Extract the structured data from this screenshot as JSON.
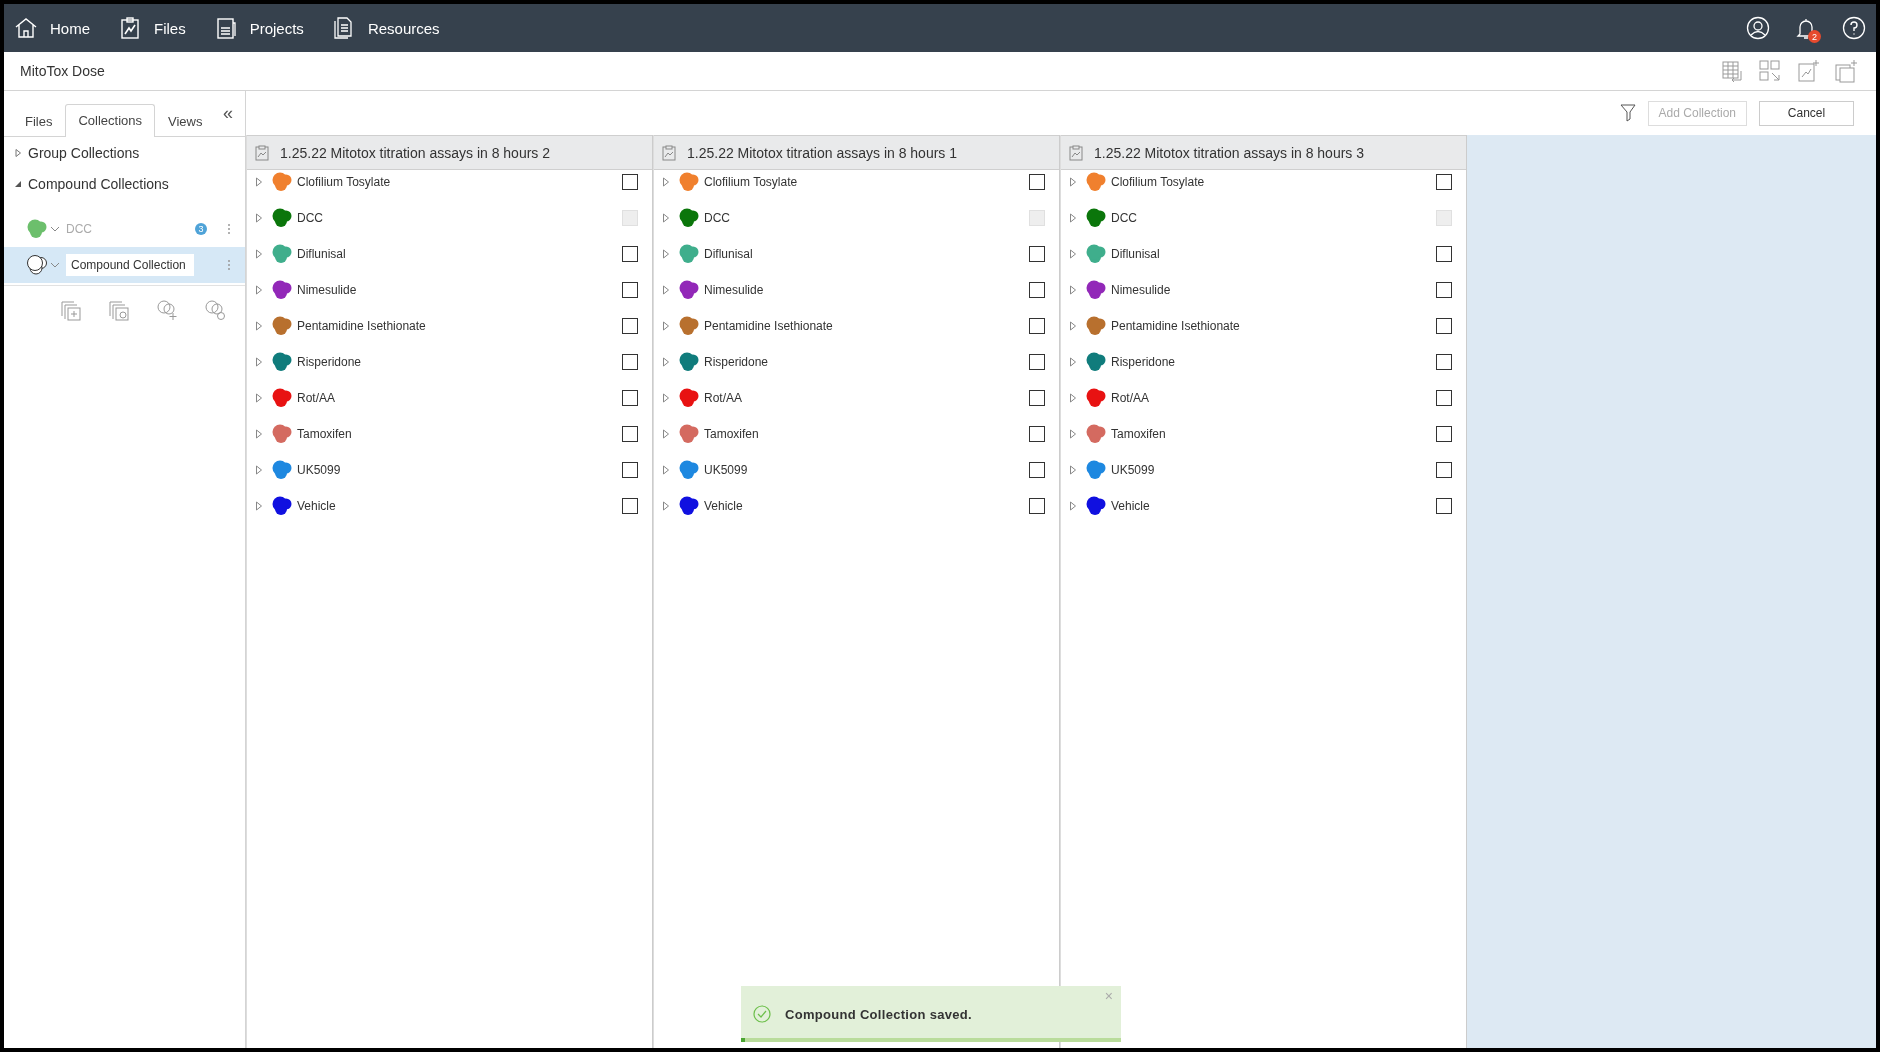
{
  "nav": {
    "items": [
      {
        "label": "Home"
      },
      {
        "label": "Files"
      },
      {
        "label": "Projects"
      },
      {
        "label": "Resources"
      }
    ],
    "notification_badge": "2"
  },
  "page_title": "MitoTox Dose",
  "sidebar": {
    "tabs": [
      {
        "label": "Files",
        "selected": false
      },
      {
        "label": "Collections",
        "selected": true
      },
      {
        "label": "Views",
        "selected": false
      }
    ],
    "collapse_glyph": "«",
    "tree": [
      {
        "label": "Group Collections",
        "expanded": false
      },
      {
        "label": "Compound Collections",
        "expanded": true,
        "children": [
          {
            "label": "DCC",
            "color": "#6cbf6c",
            "count": "3",
            "disabled": true,
            "editing": false,
            "selected": false
          },
          {
            "label": "Compound Collection",
            "color": "#ffffff",
            "disabled": false,
            "editing": true,
            "selected": true
          }
        ]
      }
    ]
  },
  "toolbar": {
    "buttons": [
      {
        "label": "Add Collection",
        "disabled": true
      },
      {
        "label": "Cancel",
        "disabled": false
      }
    ]
  },
  "columns": [
    {
      "title": "1.25.22 Mitotox titration assays in 8 hours 2",
      "items": [
        {
          "name": "Clofilium Tosylate",
          "color": "#f0802e",
          "checked": false,
          "disabled": false
        },
        {
          "name": "DCC",
          "color": "#0b760b",
          "checked": false,
          "disabled": true
        },
        {
          "name": "Diflunisal",
          "color": "#3fae8c",
          "checked": false,
          "disabled": false
        },
        {
          "name": "Nimesulide",
          "color": "#9228b8",
          "checked": false,
          "disabled": false
        },
        {
          "name": "Pentamidine Isethionate",
          "color": "#b8702e",
          "checked": false,
          "disabled": false
        },
        {
          "name": "Risperidone",
          "color": "#107c7c",
          "checked": false,
          "disabled": false
        },
        {
          "name": "Rot/AA",
          "color": "#e81212",
          "checked": false,
          "disabled": false
        },
        {
          "name": "Tamoxifen",
          "color": "#d46a60",
          "checked": false,
          "disabled": false
        },
        {
          "name": "UK5099",
          "color": "#1e88e0",
          "checked": false,
          "disabled": false
        },
        {
          "name": "Vehicle",
          "color": "#1010e0",
          "checked": false,
          "disabled": false
        }
      ]
    },
    {
      "title": "1.25.22 Mitotox titration assays in 8 hours 1",
      "items": [
        {
          "name": "Clofilium Tosylate",
          "color": "#f0802e",
          "checked": false,
          "disabled": false
        },
        {
          "name": "DCC",
          "color": "#0b760b",
          "checked": false,
          "disabled": true
        },
        {
          "name": "Diflunisal",
          "color": "#3fae8c",
          "checked": false,
          "disabled": false
        },
        {
          "name": "Nimesulide",
          "color": "#9228b8",
          "checked": false,
          "disabled": false
        },
        {
          "name": "Pentamidine Isethionate",
          "color": "#b8702e",
          "checked": false,
          "disabled": false
        },
        {
          "name": "Risperidone",
          "color": "#107c7c",
          "checked": false,
          "disabled": false
        },
        {
          "name": "Rot/AA",
          "color": "#e81212",
          "checked": false,
          "disabled": false
        },
        {
          "name": "Tamoxifen",
          "color": "#d46a60",
          "checked": false,
          "disabled": false
        },
        {
          "name": "UK5099",
          "color": "#1e88e0",
          "checked": false,
          "disabled": false
        },
        {
          "name": "Vehicle",
          "color": "#1010e0",
          "checked": false,
          "disabled": false
        }
      ]
    },
    {
      "title": "1.25.22 Mitotox titration assays in 8 hours 3",
      "items": [
        {
          "name": "Clofilium Tosylate",
          "color": "#f0802e",
          "checked": false,
          "disabled": false
        },
        {
          "name": "DCC",
          "color": "#0b760b",
          "checked": false,
          "disabled": true
        },
        {
          "name": "Diflunisal",
          "color": "#3fae8c",
          "checked": false,
          "disabled": false
        },
        {
          "name": "Nimesulide",
          "color": "#9228b8",
          "checked": false,
          "disabled": false
        },
        {
          "name": "Pentamidine Isethionate",
          "color": "#b8702e",
          "checked": false,
          "disabled": false
        },
        {
          "name": "Risperidone",
          "color": "#107c7c",
          "checked": false,
          "disabled": false
        },
        {
          "name": "Rot/AA",
          "color": "#e81212",
          "checked": false,
          "disabled": false
        },
        {
          "name": "Tamoxifen",
          "color": "#d46a60",
          "checked": false,
          "disabled": false
        },
        {
          "name": "UK5099",
          "color": "#1e88e0",
          "checked": false,
          "disabled": false
        },
        {
          "name": "Vehicle",
          "color": "#1010e0",
          "checked": false,
          "disabled": false
        }
      ]
    }
  ],
  "toast": {
    "message": "Compound Collection saved.",
    "close_glyph": "×",
    "level": 0.01
  }
}
